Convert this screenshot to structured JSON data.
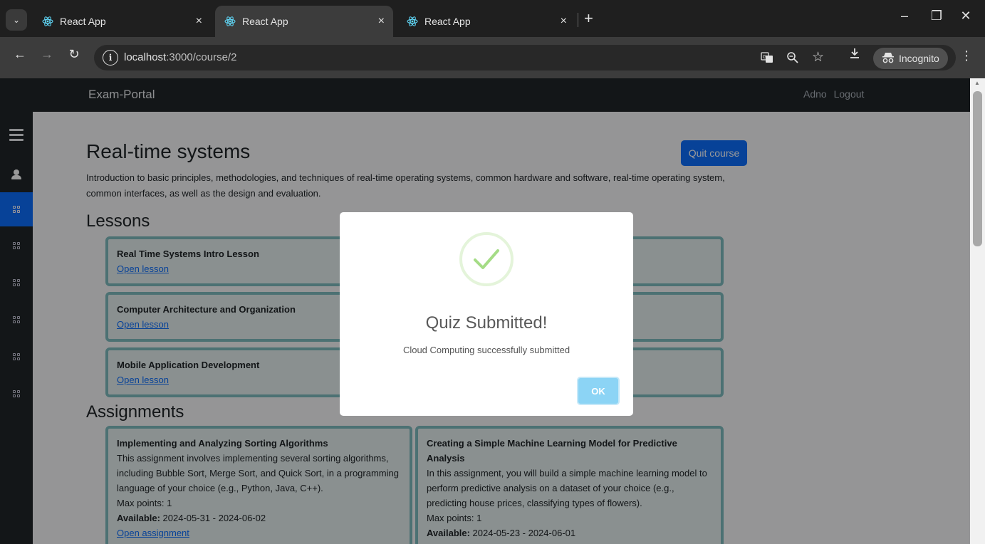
{
  "browser": {
    "tabs": [
      {
        "title": "React App",
        "close": "×"
      },
      {
        "title": "React App",
        "close": "×"
      },
      {
        "title": "React App",
        "close": "×"
      }
    ],
    "new_tab": "+",
    "url_host": "localhost",
    "url_path": ":3000/course/2",
    "incognito_label": "Incognito",
    "window_controls": {
      "minimize": "–",
      "restore": "❐",
      "close": "✕"
    }
  },
  "app": {
    "brand": "Exam-Portal",
    "user": "Adno",
    "logout": "Logout"
  },
  "course": {
    "title": "Real-time systems",
    "quit_label": "Quit course",
    "description": "Introduction to basic principles, methodologies, and techniques of real-time operating systems, common hardware and software, real-time operating system, common interfaces, as well as the design and evaluation."
  },
  "lessons": {
    "heading": "Lessons",
    "items": [
      {
        "title": "Real Time Systems Intro Lesson",
        "link": "Open lesson"
      },
      {
        "title": "Computer Architecture and Organization",
        "link": "Open lesson"
      },
      {
        "title": "Mobile Application Development",
        "link": "Open lesson"
      }
    ]
  },
  "assignments": {
    "heading": "Assignments",
    "items": [
      {
        "title": "Implementing and Analyzing Sorting Algorithms",
        "description": "This assignment involves implementing several sorting algorithms, including Bubble Sort, Merge Sort, and Quick Sort, in a programming language of your choice (e.g., Python, Java, C++).",
        "points": "Max points: 1",
        "available_label": "Available:",
        "available_range": " 2024-05-31 - 2024-06-02",
        "link": "Open assignment"
      },
      {
        "title": "Creating a Simple Machine Learning Model for Predictive Analysis",
        "description": "In this assignment, you will build a simple machine learning model to perform predictive analysis on a dataset of your choice (e.g., predicting house prices, classifying types of flowers).",
        "points": "Max points: 1",
        "available_label": "Available:",
        "available_range": " 2024-05-23 - 2024-06-01"
      }
    ]
  },
  "dialog": {
    "title": "Quiz Submitted!",
    "text": "Cloud Computing successfully submitted",
    "ok": "OK"
  }
}
